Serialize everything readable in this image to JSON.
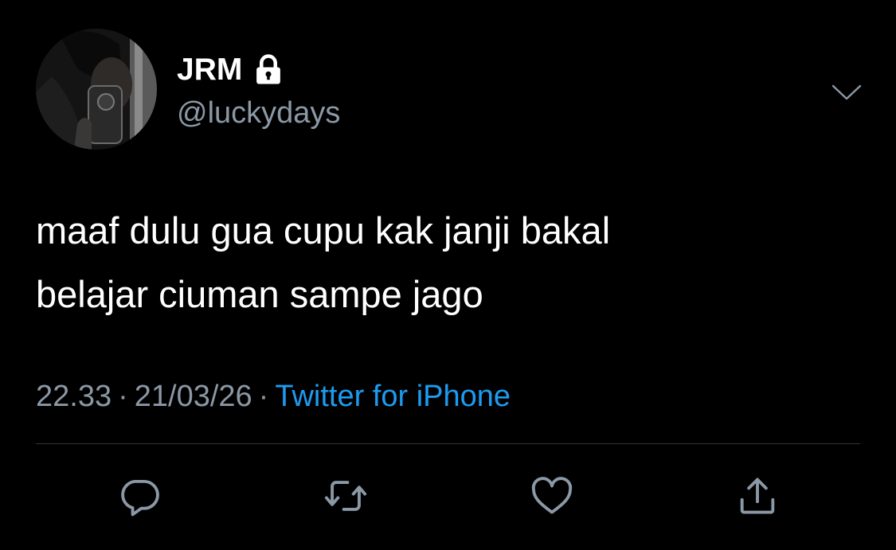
{
  "tweet": {
    "display_name": "JRM",
    "handle": "@luckydays",
    "text_lines": [
      "maaf dulu gua cupu kak janji bakal",
      "belajar ciuman sampe jago"
    ],
    "time": "22.33",
    "separator": "·",
    "date": "21/03/26",
    "source": "Twitter for iPhone"
  },
  "icons": {
    "lock": "lock-icon",
    "menu": "chevron-down-icon",
    "reply": "reply-icon",
    "retweet": "retweet-icon",
    "like": "heart-icon",
    "share": "share-icon"
  },
  "colors": {
    "background": "#000000",
    "primary_text": "#ffffff",
    "secondary_text": "#8b98a5",
    "link": "#1d9bf0",
    "divider": "#2f3336"
  }
}
